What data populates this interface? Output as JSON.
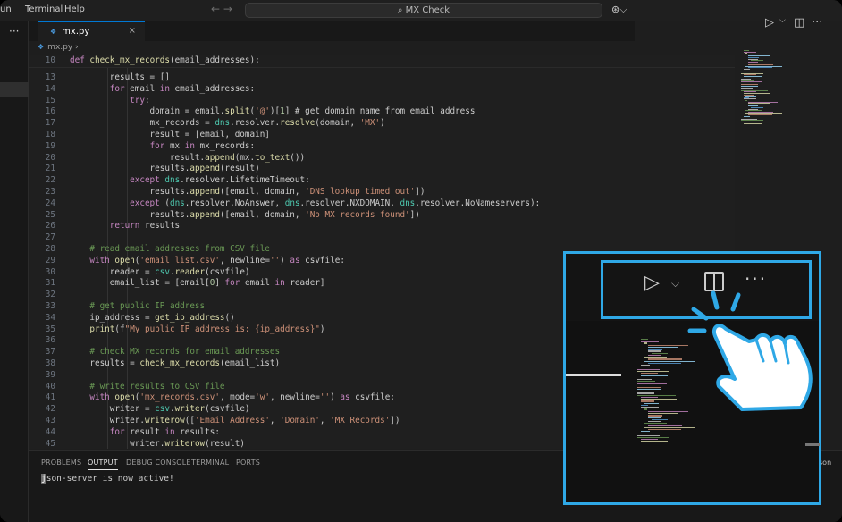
{
  "titlebar": {
    "menu_items": [
      "un",
      "Terminal",
      "Help"
    ],
    "nav_arrows": "←  →",
    "search_text": "MX Check",
    "account_icon": "copilot-icon"
  },
  "tab": {
    "filename": "mx.py",
    "close": "×"
  },
  "breadcrumb": {
    "file": "mx.py",
    "separator": "›"
  },
  "editor_actions": {
    "run_icon": "▷",
    "chevron": "⌵",
    "split_icon": "◫",
    "more_icon": "···"
  },
  "code": {
    "sticky_line": {
      "number": "10",
      "text": "def check_mx_records(email_addresses):"
    },
    "lines": [
      {
        "number": "13",
        "text": "        results = []"
      },
      {
        "number": "14",
        "text": "        for email in email_addresses:"
      },
      {
        "number": "15",
        "text": "            try:"
      },
      {
        "number": "16",
        "text": "                domain = email.split('@')[1] # get domain name from email address"
      },
      {
        "number": "17",
        "text": "                mx_records = dns.resolver.resolve(domain, 'MX')"
      },
      {
        "number": "18",
        "text": "                result = [email, domain]"
      },
      {
        "number": "19",
        "text": "                for mx in mx_records:"
      },
      {
        "number": "20",
        "text": "                    result.append(mx.to_text())"
      },
      {
        "number": "21",
        "text": "                results.append(result)"
      },
      {
        "number": "22",
        "text": "            except dns.resolver.LifetimeTimeout:"
      },
      {
        "number": "23",
        "text": "                results.append([email, domain, 'DNS lookup timed out'])"
      },
      {
        "number": "24",
        "text": "            except (dns.resolver.NoAnswer, dns.resolver.NXDOMAIN, dns.resolver.NoNameservers):"
      },
      {
        "number": "25",
        "text": "                results.append([email, domain, 'No MX records found'])"
      },
      {
        "number": "26",
        "text": "        return results"
      },
      {
        "number": "27",
        "text": ""
      },
      {
        "number": "28",
        "text": "    # read email addresses from CSV file"
      },
      {
        "number": "29",
        "text": "    with open('email_list.csv', newline='') as csvfile:"
      },
      {
        "number": "30",
        "text": "        reader = csv.reader(csvfile)"
      },
      {
        "number": "31",
        "text": "        email_list = [email[0] for email in reader]"
      },
      {
        "number": "32",
        "text": ""
      },
      {
        "number": "33",
        "text": "    # get public IP address"
      },
      {
        "number": "34",
        "text": "    ip_address = get_ip_address()"
      },
      {
        "number": "35",
        "text": "    print(f\"My public IP address is: {ip_address}\")"
      },
      {
        "number": "36",
        "text": ""
      },
      {
        "number": "37",
        "text": "    # check MX records for email addresses"
      },
      {
        "number": "38",
        "text": "    results = check_mx_records(email_list)"
      },
      {
        "number": "39",
        "text": ""
      },
      {
        "number": "40",
        "text": "    # write results to CSV file"
      },
      {
        "number": "41",
        "text": "    with open('mx_records.csv', mode='w', newline='') as csvfile:"
      },
      {
        "number": "42",
        "text": "        writer = csv.writer(csvfile)"
      },
      {
        "number": "43",
        "text": "        writer.writerow(['Email Address', 'Domain', 'MX Records'])"
      },
      {
        "number": "44",
        "text": "        for result in results:"
      },
      {
        "number": "45",
        "text": "            writer.writerow(result)"
      }
    ]
  },
  "panel": {
    "tabs": [
      "PROBLEMS",
      "OUTPUT",
      "DEBUG CONSOLE",
      "TERMINAL",
      "PORTS"
    ],
    "active_tab": "OUTPUT",
    "output_first_char": "j",
    "output_rest": "son-server is now active!",
    "right_edge_label": "son"
  },
  "colors": {
    "accent": "#2fa8e6",
    "editor_bg": "#1f1f1f"
  }
}
